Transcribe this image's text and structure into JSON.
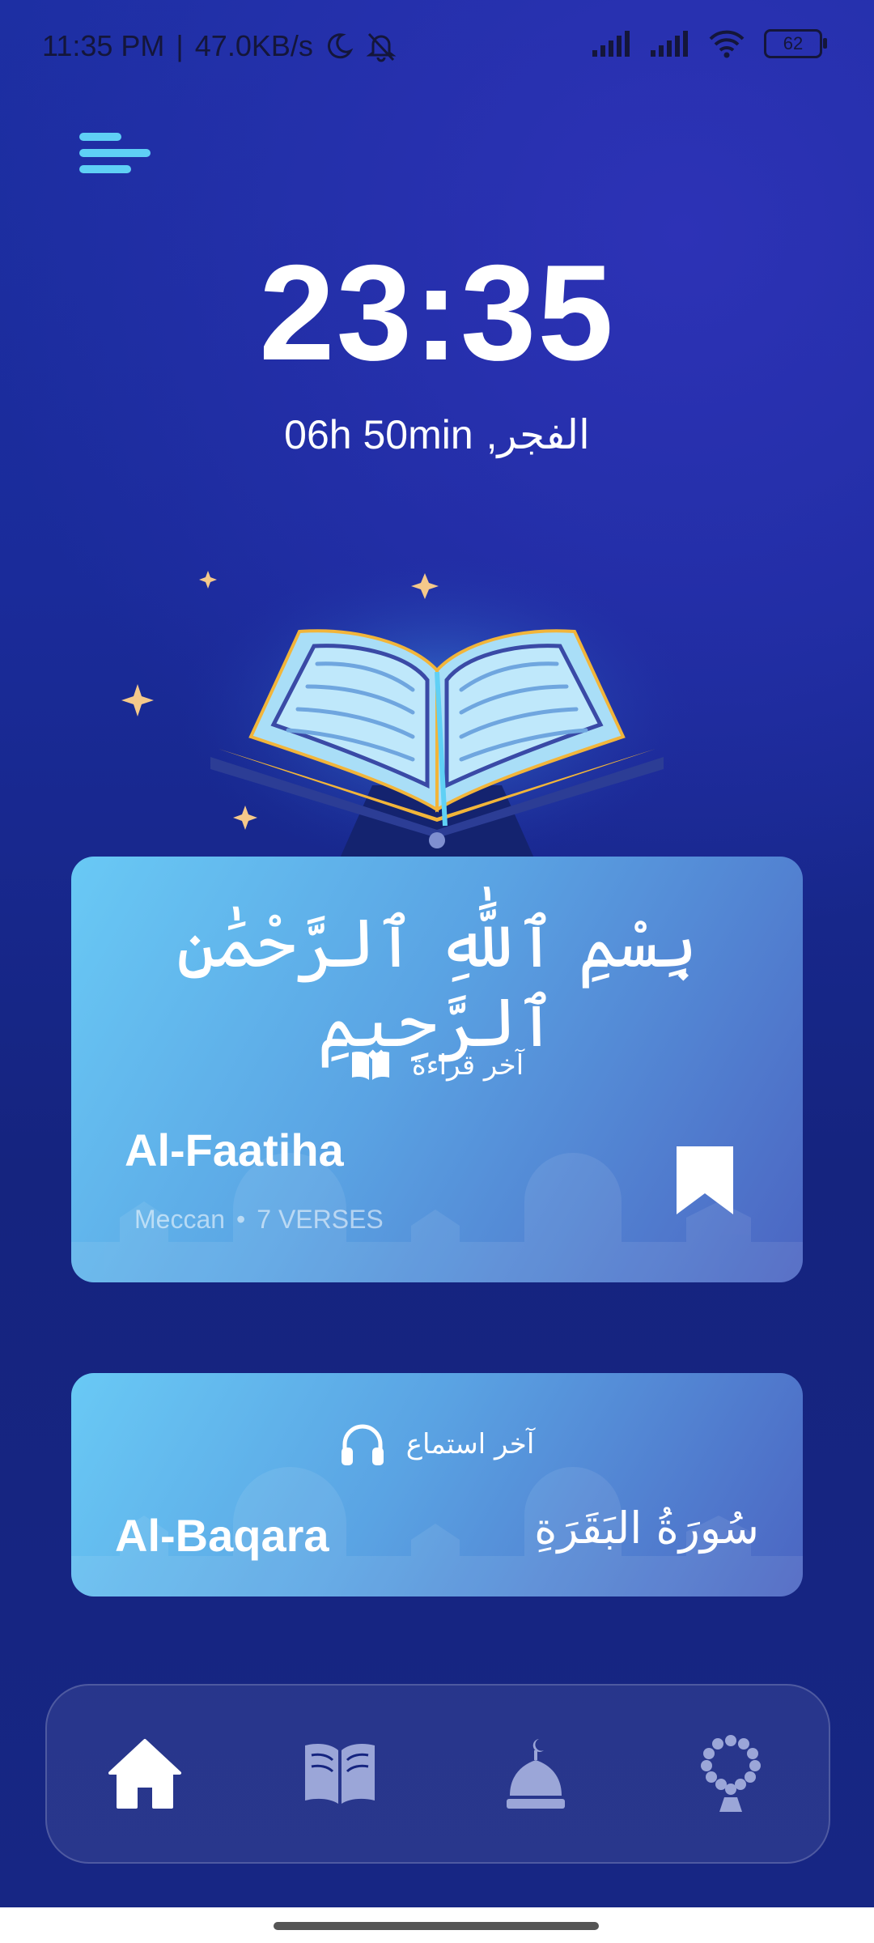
{
  "status_bar": {
    "time": "11:35 PM",
    "separator": "|",
    "speed": "47.0KB/s",
    "battery": "62",
    "icons": [
      "moon-icon",
      "bell-off-icon",
      "signal-icon",
      "signal-icon",
      "wifi-icon",
      "battery-icon"
    ]
  },
  "header": {
    "menu_icon": "menu-icon",
    "clock": "23:35",
    "countdown": "06h 50min",
    "prayer_name": "الفجر,"
  },
  "last_read": {
    "bismillah": "بِسْمِ ٱللَّٰهِ ٱلرَّحْمَٰنِ ٱلرَّحِيمِ",
    "label": "آخر قراءة",
    "surah": "Al-Faatiha",
    "revelation": "Meccan",
    "dot": "•",
    "verses": "7 VERSES",
    "icon": "book-open-icon",
    "bookmark_icon": "bookmark-icon"
  },
  "last_listen": {
    "label": "آخر استماع",
    "surah": "Al-Baqara",
    "surah_arabic": "سُورَةُ البَقَرَةِ",
    "icon": "headphones-icon"
  },
  "nav": {
    "items": [
      {
        "name": "home",
        "icon": "home-icon",
        "active": true
      },
      {
        "name": "quran",
        "icon": "quran-book-icon",
        "active": false
      },
      {
        "name": "mosque",
        "icon": "mosque-dome-icon",
        "active": false
      },
      {
        "name": "tasbih",
        "icon": "prayer-beads-icon",
        "active": false
      }
    ]
  },
  "colors": {
    "accent": "#5fd0f5",
    "card_start": "#69c9f5",
    "card_end": "#4b65c2",
    "nav_inactive": "#9ba6d8"
  }
}
